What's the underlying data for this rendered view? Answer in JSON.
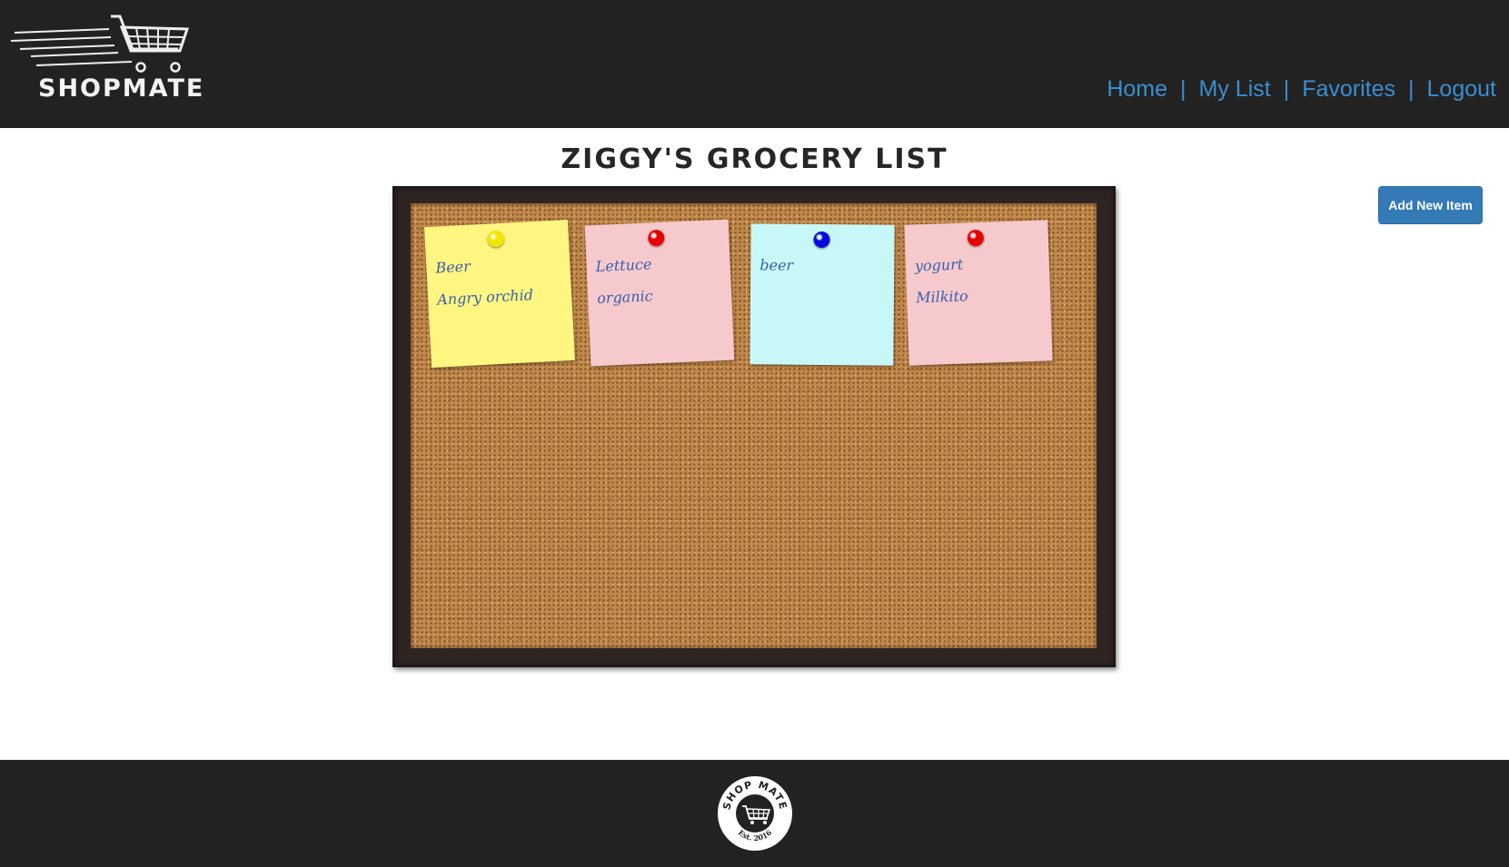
{
  "header": {
    "logo_text": "SHOPMATE",
    "nav": {
      "home": "Home",
      "my_list": "My List",
      "favorites": "Favorites",
      "logout": "Logout",
      "separator": "|"
    }
  },
  "main": {
    "title": "ZIGGY'S GROCERY LIST",
    "add_button": "Add New Item",
    "notes": [
      {
        "item": "Beer",
        "detail": "Angry orchid",
        "color": "#fff681",
        "pin_color": "#f2e600"
      },
      {
        "item": "Lettuce",
        "detail": "organic",
        "color": "#f6cacd",
        "pin_color": "#e60000"
      },
      {
        "item": "beer",
        "detail": "",
        "color": "#c8f7f7",
        "pin_color": "#0a0ae0"
      },
      {
        "item": "yogurt",
        "detail": "Milkito",
        "color": "#f6cacd",
        "pin_color": "#e60000"
      }
    ]
  },
  "footer": {
    "badge_top": "SHOP MATE",
    "badge_bottom": "Est. 2016"
  },
  "colors": {
    "header_bg": "#222222",
    "nav_link": "#3a8fd0",
    "button_bg": "#337ab7"
  }
}
